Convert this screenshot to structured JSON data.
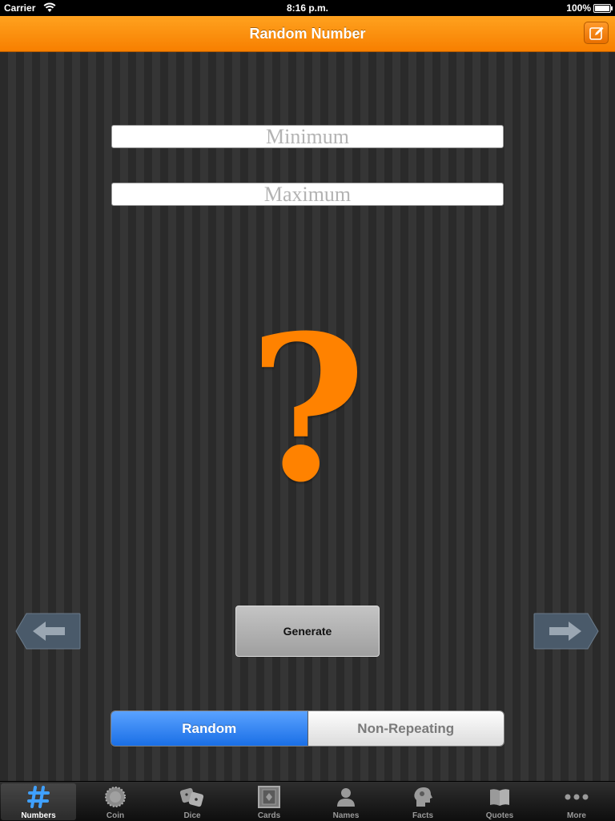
{
  "status_bar": {
    "carrier": "Carrier",
    "time": "8:16 p.m.",
    "battery": "100%"
  },
  "nav": {
    "title": "Random Number",
    "right_icon": "compose-icon"
  },
  "inputs": {
    "minimum_placeholder": "Minimum",
    "maximum_placeholder": "Maximum",
    "minimum_value": "",
    "maximum_value": ""
  },
  "result": {
    "display": "?"
  },
  "buttons": {
    "generate": "Generate",
    "prev_icon": "arrow-left-icon",
    "next_icon": "arrow-right-icon"
  },
  "mode": {
    "options": [
      "Random",
      "Non-Repeating"
    ],
    "selected": "Random"
  },
  "tabs": [
    {
      "label": "Numbers",
      "icon": "hash-icon",
      "selected": true
    },
    {
      "label": "Coin",
      "icon": "coin-icon",
      "selected": false
    },
    {
      "label": "Dice",
      "icon": "dice-icon",
      "selected": false
    },
    {
      "label": "Cards",
      "icon": "cards-icon",
      "selected": false
    },
    {
      "label": "Names",
      "icon": "person-icon",
      "selected": false
    },
    {
      "label": "Facts",
      "icon": "head-icon",
      "selected": false
    },
    {
      "label": "Quotes",
      "icon": "book-icon",
      "selected": false
    },
    {
      "label": "More",
      "icon": "more-icon",
      "selected": false
    }
  ],
  "colors": {
    "accent": "#f78a00",
    "selected_segment": "#2a7ff0"
  }
}
